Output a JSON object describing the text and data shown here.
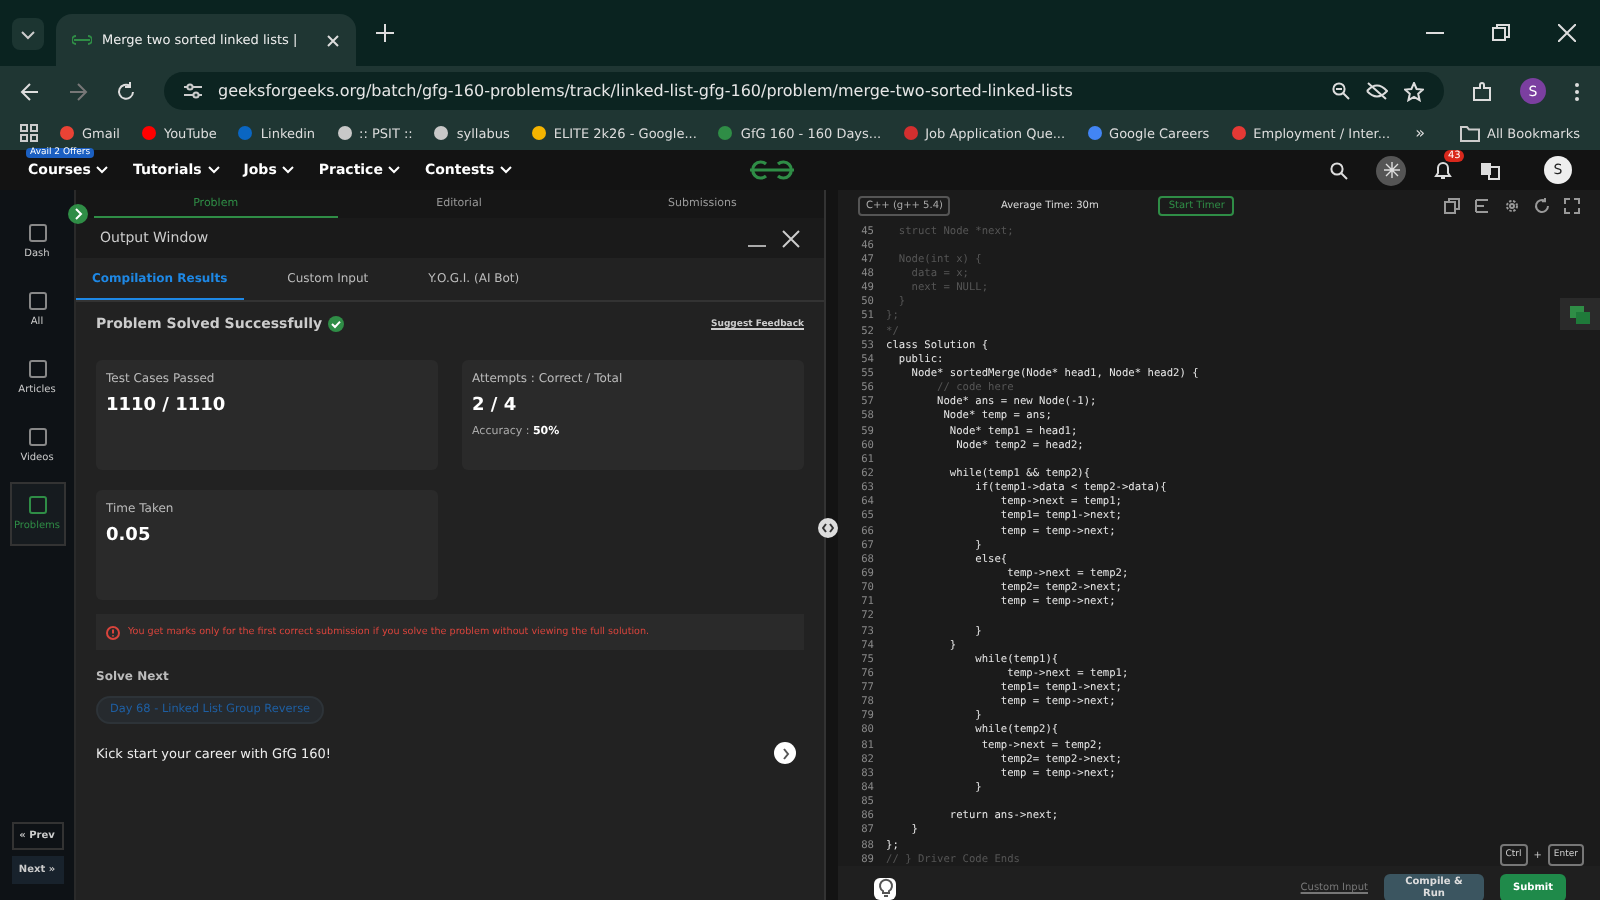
{
  "browser": {
    "tab_title": "Merge two sorted linked lists | ",
    "url": "geeksforgeeks.org/batch/gfg-160-problems/track/linked-list-gfg-160/problem/merge-two-sorted-linked-lists",
    "profile": "S",
    "bookmarks": [
      {
        "label": "Gmail",
        "color": "#ea4335"
      },
      {
        "label": "YouTube",
        "color": "#ff0000"
      },
      {
        "label": "Linkedin",
        "color": "#0a66c2"
      },
      {
        "label": ":: PSIT ::",
        "color": "#c8c8c8"
      },
      {
        "label": "syllabus",
        "color": "#c8c8c8"
      },
      {
        "label": "ELITE 2k26 - Google...",
        "color": "#f4b400"
      },
      {
        "label": "GfG 160 - 160 Days...",
        "color": "#2f8d46"
      },
      {
        "label": "Job Application Que...",
        "color": "#d32f2f"
      },
      {
        "label": "Google Careers",
        "color": "#4285f4"
      },
      {
        "label": "Employment / Inter...",
        "color": "#e53935"
      }
    ],
    "more": "»",
    "all_bookmarks": "All Bookmarks"
  },
  "site_nav": {
    "badge": "Avail 2 Offers",
    "menus": [
      "Courses",
      "Tutorials",
      "Jobs",
      "Practice",
      "Contests"
    ],
    "notifications": "43",
    "avatar": "S"
  },
  "sidebar": {
    "items": [
      {
        "label": "Dash",
        "selected": false
      },
      {
        "label": "All",
        "selected": false
      },
      {
        "label": "Articles",
        "selected": false
      },
      {
        "label": "Videos",
        "selected": false
      },
      {
        "label": "Problems",
        "selected": true
      }
    ],
    "prev": "« Prev",
    "next": "Next »"
  },
  "problem_tabs": [
    {
      "label": "Problem",
      "selected": true
    },
    {
      "label": "Editorial",
      "selected": false
    },
    {
      "label": "Submissions",
      "selected": false
    }
  ],
  "output_window": {
    "title": "Output Window",
    "tabs": [
      {
        "label": "Compilation Results",
        "selected": true
      },
      {
        "label": "Custom Input",
        "selected": false
      },
      {
        "label": "Y.O.G.I. (AI Bot)",
        "selected": false
      }
    ],
    "status": "Problem Solved Successfully",
    "feedback": "Suggest Feedback",
    "cards": [
      {
        "label": "Test Cases Passed",
        "value": "1110 / 1110"
      },
      {
        "label": "Attempts : Correct / Total",
        "value": "2 / 4",
        "note_label": "Accuracy :",
        "note_value": "50%"
      },
      {
        "label": "Time Taken",
        "value": "0.05"
      }
    ],
    "warning": "You get marks only for the first correct submission if you solve the problem without viewing the full solution.",
    "solve_next": "Solve Next",
    "next_problem": "Day 68 - Linked List Group Reverse",
    "promo": "Kick start your career with GfG 160!"
  },
  "editor": {
    "language": "C++ (g++ 5.4)",
    "average_time": "Average Time: 30m",
    "timer": "Start Timer",
    "lines": [
      {
        "n": "45",
        "text": "  struct Node *next;",
        "comment": true
      },
      {
        "n": "46"
      },
      {
        "n": "47",
        "text": "  Node(int x) {",
        "comment": true
      },
      {
        "n": "48",
        "text": "    data = x;",
        "comment": true
      },
      {
        "n": "49",
        "text": "    next = NULL;",
        "comment": true
      },
      {
        "n": "50",
        "text": "  }",
        "comment": true
      },
      {
        "n": "51",
        "text": "};",
        "comment": true
      },
      {
        "n": "52",
        "text": "*/",
        "comment": true
      },
      {
        "n": "53",
        "text": "class Solution {",
        "comment": false
      },
      {
        "n": "54",
        "text": "  public:",
        "comment": false
      },
      {
        "n": "55",
        "text": "    Node* sortedMerge(Node* head1, Node* head2) {",
        "comment": false
      },
      {
        "n": "56",
        "text": "        // code here",
        "comment": true
      },
      {
        "n": "57",
        "text": "        Node* ans = new Node(-1);",
        "comment": false
      },
      {
        "n": "58",
        "text": "         Node* temp = ans;",
        "comment": false
      },
      {
        "n": "59",
        "text": "          Node* temp1 = head1;",
        "comment": false
      },
      {
        "n": "60",
        "text": "           Node* temp2 = head2;",
        "comment": false
      },
      {
        "n": "61"
      },
      {
        "n": "62",
        "text": "          while(temp1 && temp2){",
        "comment": false
      },
      {
        "n": "63",
        "text": "              if(temp1->data < temp2->data){",
        "comment": false
      },
      {
        "n": "64",
        "text": "                  temp->next = temp1;",
        "comment": false
      },
      {
        "n": "65",
        "text": "                  temp1= temp1->next;",
        "comment": false
      },
      {
        "n": "66",
        "text": "                  temp = temp->next;",
        "comment": false
      },
      {
        "n": "67",
        "text": "              }",
        "comment": false
      },
      {
        "n": "68",
        "text": "              else{",
        "comment": false
      },
      {
        "n": "69",
        "text": "                   temp->next = temp2;",
        "comment": false
      },
      {
        "n": "70",
        "text": "                  temp2= temp2->next;",
        "comment": false
      },
      {
        "n": "71",
        "text": "                  temp = temp->next;",
        "comment": false
      },
      {
        "n": "72"
      },
      {
        "n": "73",
        "text": "              }",
        "comment": false
      },
      {
        "n": "74",
        "text": "          }",
        "comment": false
      },
      {
        "n": "75",
        "text": "              while(temp1){",
        "comment": false
      },
      {
        "n": "76",
        "text": "                   temp->next = temp1;",
        "comment": false
      },
      {
        "n": "77",
        "text": "                  temp1= temp1->next;",
        "comment": false
      },
      {
        "n": "78",
        "text": "                  temp = temp->next;",
        "comment": false
      },
      {
        "n": "79",
        "text": "              }",
        "comment": false
      },
      {
        "n": "80",
        "text": "              while(temp2){",
        "comment": false
      },
      {
        "n": "81",
        "text": "               temp->next = temp2;",
        "comment": false
      },
      {
        "n": "82",
        "text": "                  temp2= temp2->next;",
        "comment": false
      },
      {
        "n": "83",
        "text": "                  temp = temp->next;",
        "comment": false
      },
      {
        "n": "84",
        "text": "              }",
        "comment": false
      },
      {
        "n": "85"
      },
      {
        "n": "86",
        "text": "          return ans->next;",
        "comment": false
      },
      {
        "n": "87",
        "text": "    }",
        "comment": false
      },
      {
        "n": "88",
        "text": "};",
        "comment": false
      },
      {
        "n": "89",
        "text": "// } Driver Code Ends",
        "comment": true
      }
    ],
    "keys": [
      "Ctrl",
      "Enter"
    ],
    "plus": "+",
    "custom_input": "Custom Input",
    "compile": "Compile & Run",
    "submit": "Submit"
  }
}
